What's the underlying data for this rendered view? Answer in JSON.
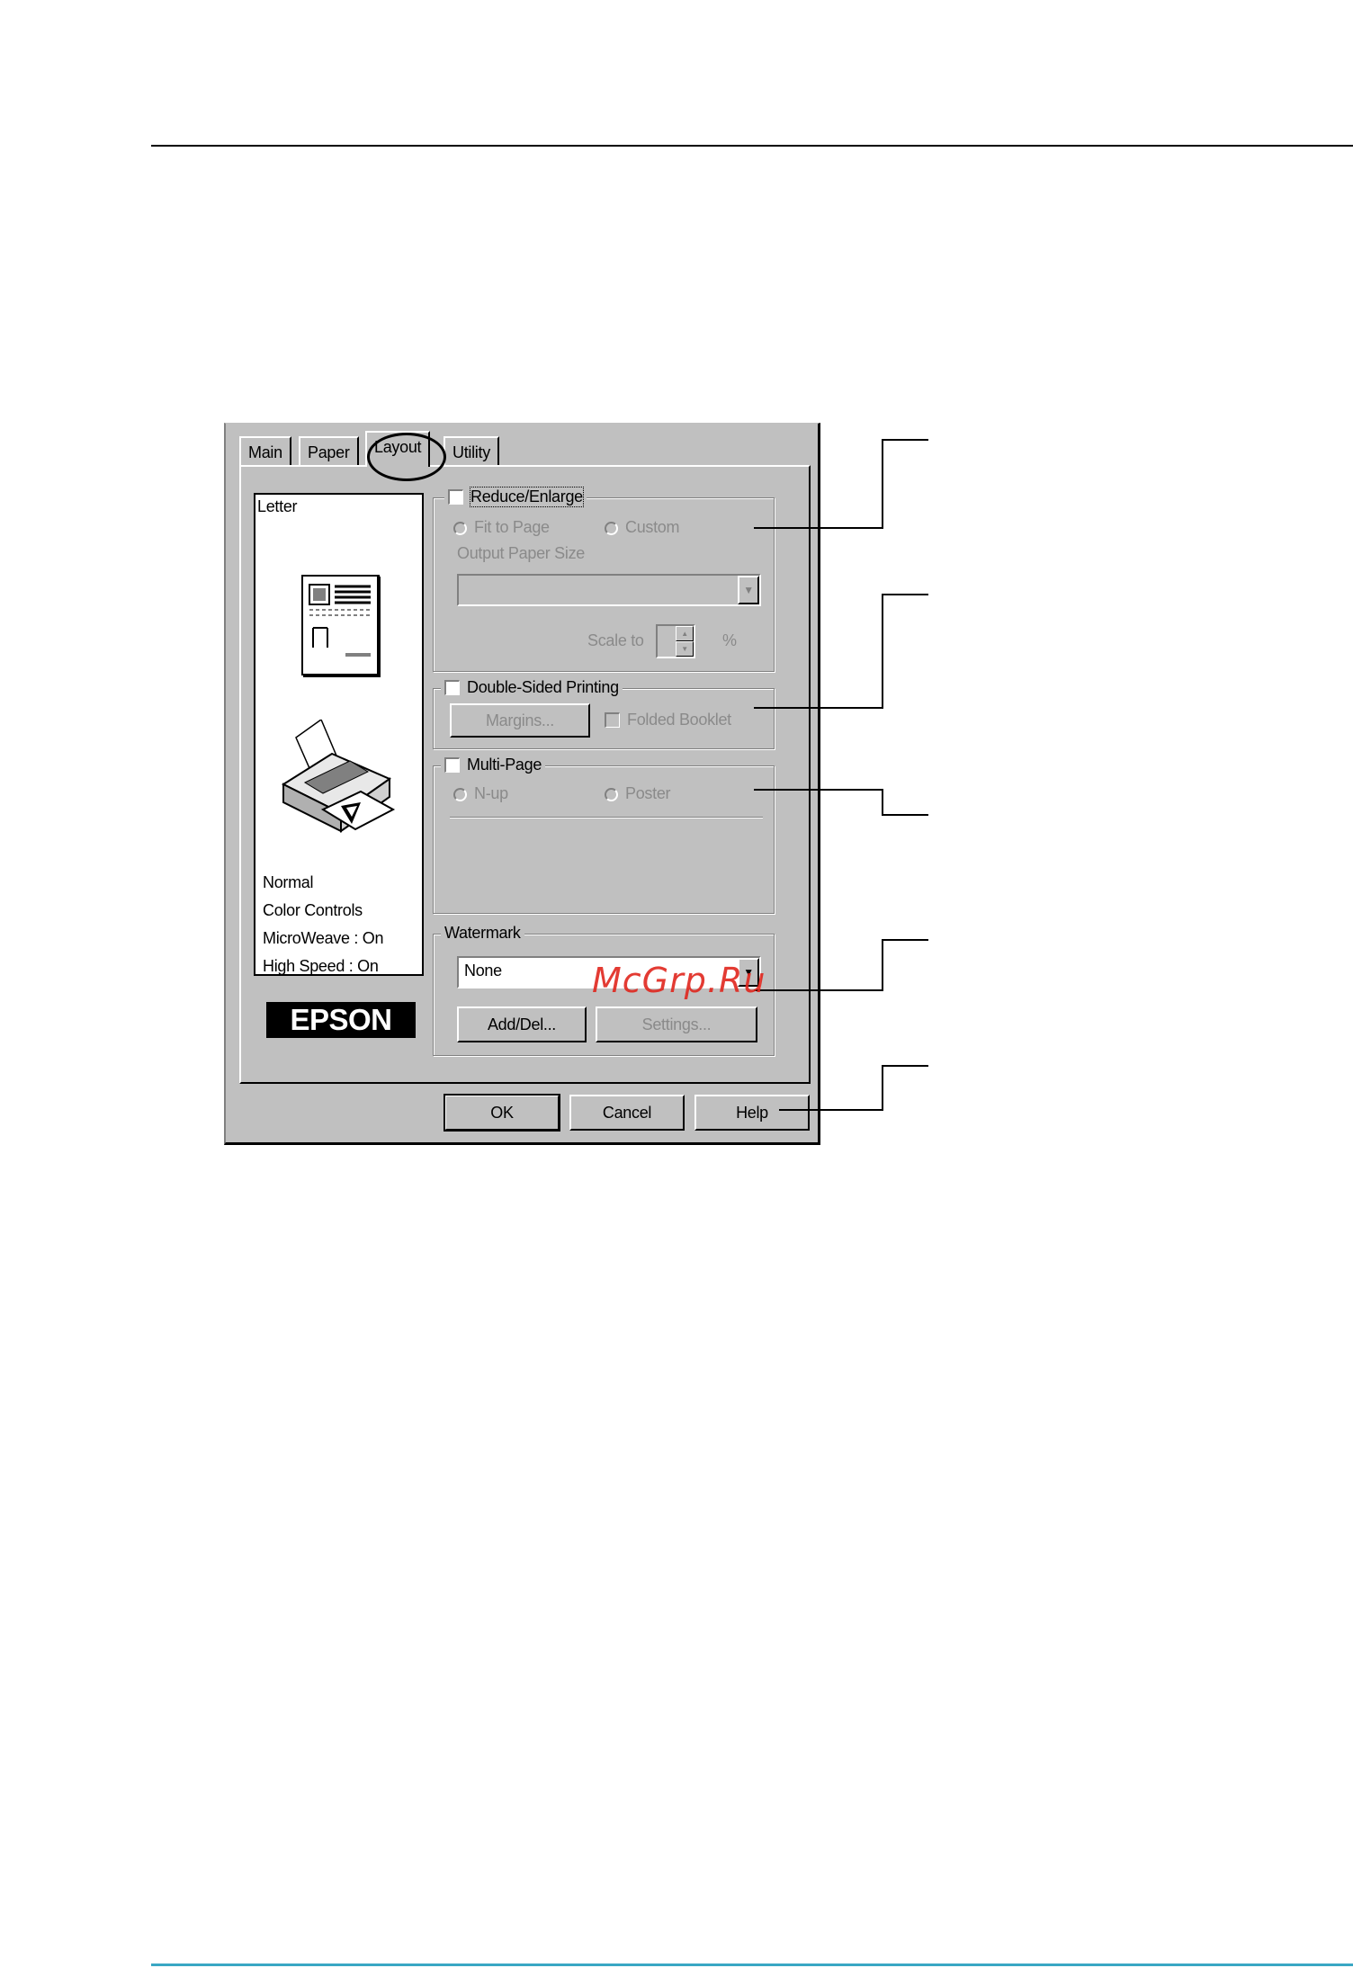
{
  "dialog": {
    "tabs": [
      "Main",
      "Paper",
      "Layout",
      "Utility"
    ],
    "active_tab": "Layout",
    "preview": {
      "paper": "Letter",
      "status": [
        "Normal",
        "Color Controls",
        "MicroWeave : On",
        "High Speed : On"
      ],
      "logo": "EPSON"
    },
    "reduce_enlarge": {
      "label": "Reduce/Enlarge",
      "fit_to_page": "Fit to Page",
      "custom": "Custom",
      "output_paper_size": "Output Paper Size",
      "scale_to": "Scale to",
      "percent": "%"
    },
    "double_sided": {
      "label": "Double-Sided Printing",
      "margins": "Margins...",
      "folded_booklet": "Folded Booklet"
    },
    "multi_page": {
      "label": "Multi-Page",
      "n_up": "N-up",
      "poster": "Poster"
    },
    "watermark": {
      "label": "Watermark",
      "selected": "None",
      "add_del": "Add/Del...",
      "settings": "Settings..."
    },
    "buttons": {
      "ok": "OK",
      "cancel": "Cancel",
      "help": "Help"
    }
  },
  "overlay_text": "McGrp.Ru",
  "colors": {
    "dialog_bg": "#c0c0c0",
    "accent_rule": "#3aa7c4",
    "overlay": "#e0261e"
  }
}
